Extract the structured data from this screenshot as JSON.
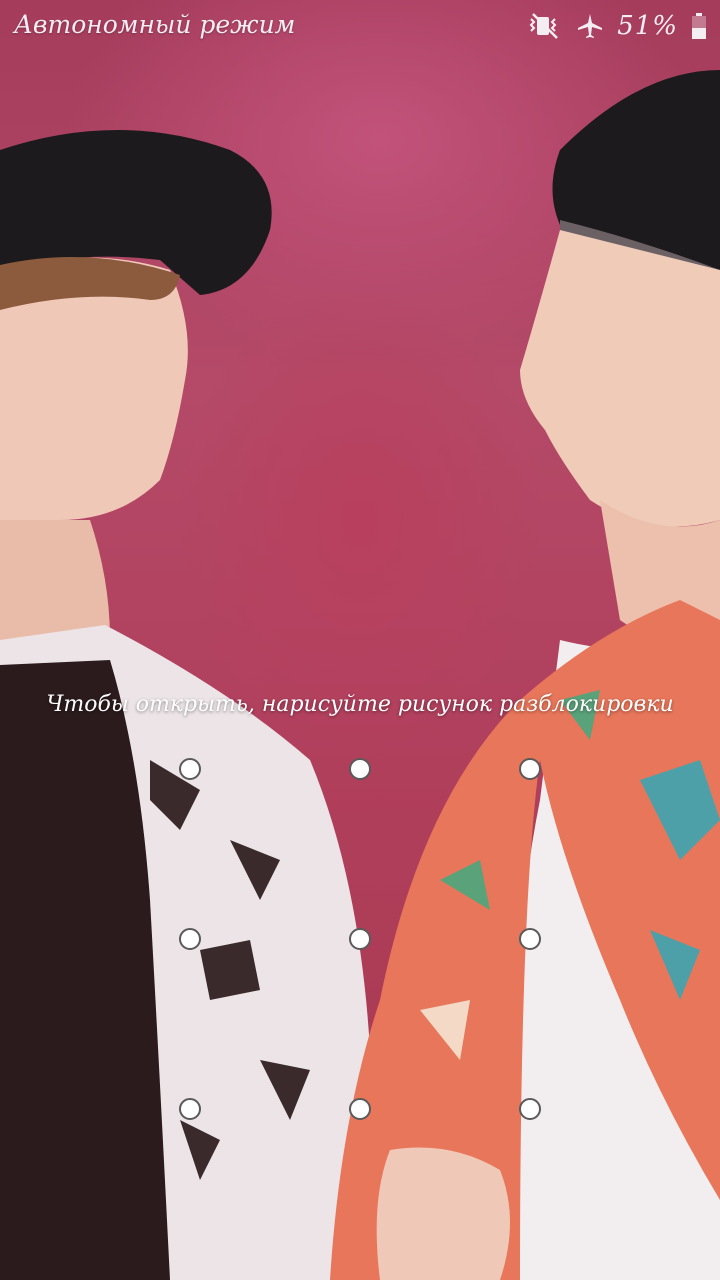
{
  "status_bar": {
    "mode_label": "Автономный режим",
    "battery_percent": "51%",
    "icons": [
      "vibrate-icon",
      "airplane-icon",
      "battery-icon"
    ]
  },
  "lock_screen": {
    "hint": "Чтобы открыть, нарисуйте рисунок разблокировки",
    "pattern_dots": 9
  },
  "colors": {
    "wallpaper_base": "#b03f5c",
    "dot_fill": "#ffffff",
    "dot_border": "#5a5a5a",
    "text": "#ffffff"
  }
}
